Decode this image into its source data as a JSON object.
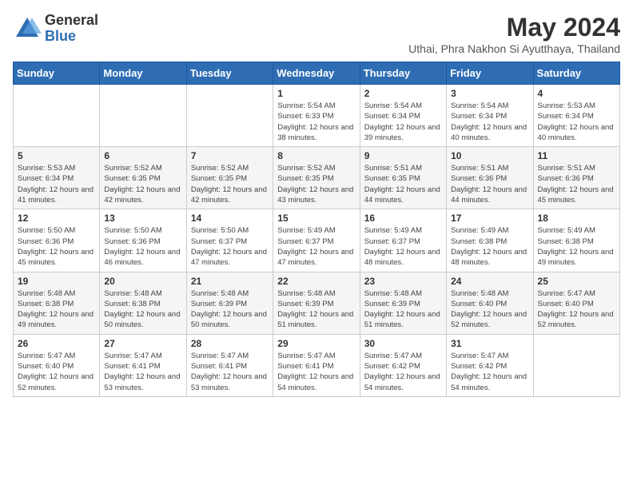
{
  "header": {
    "logo_general": "General",
    "logo_blue": "Blue",
    "main_title": "May 2024",
    "subtitle": "Uthai, Phra Nakhon Si Ayutthaya, Thailand"
  },
  "weekdays": [
    "Sunday",
    "Monday",
    "Tuesday",
    "Wednesday",
    "Thursday",
    "Friday",
    "Saturday"
  ],
  "weeks": [
    [
      {
        "day": "",
        "info": ""
      },
      {
        "day": "",
        "info": ""
      },
      {
        "day": "",
        "info": ""
      },
      {
        "day": "1",
        "info": "Sunrise: 5:54 AM\nSunset: 6:33 PM\nDaylight: 12 hours and 38 minutes."
      },
      {
        "day": "2",
        "info": "Sunrise: 5:54 AM\nSunset: 6:34 PM\nDaylight: 12 hours and 39 minutes."
      },
      {
        "day": "3",
        "info": "Sunrise: 5:54 AM\nSunset: 6:34 PM\nDaylight: 12 hours and 40 minutes."
      },
      {
        "day": "4",
        "info": "Sunrise: 5:53 AM\nSunset: 6:34 PM\nDaylight: 12 hours and 40 minutes."
      }
    ],
    [
      {
        "day": "5",
        "info": "Sunrise: 5:53 AM\nSunset: 6:34 PM\nDaylight: 12 hours and 41 minutes."
      },
      {
        "day": "6",
        "info": "Sunrise: 5:52 AM\nSunset: 6:35 PM\nDaylight: 12 hours and 42 minutes."
      },
      {
        "day": "7",
        "info": "Sunrise: 5:52 AM\nSunset: 6:35 PM\nDaylight: 12 hours and 42 minutes."
      },
      {
        "day": "8",
        "info": "Sunrise: 5:52 AM\nSunset: 6:35 PM\nDaylight: 12 hours and 43 minutes."
      },
      {
        "day": "9",
        "info": "Sunrise: 5:51 AM\nSunset: 6:35 PM\nDaylight: 12 hours and 44 minutes."
      },
      {
        "day": "10",
        "info": "Sunrise: 5:51 AM\nSunset: 6:36 PM\nDaylight: 12 hours and 44 minutes."
      },
      {
        "day": "11",
        "info": "Sunrise: 5:51 AM\nSunset: 6:36 PM\nDaylight: 12 hours and 45 minutes."
      }
    ],
    [
      {
        "day": "12",
        "info": "Sunrise: 5:50 AM\nSunset: 6:36 PM\nDaylight: 12 hours and 45 minutes."
      },
      {
        "day": "13",
        "info": "Sunrise: 5:50 AM\nSunset: 6:36 PM\nDaylight: 12 hours and 46 minutes."
      },
      {
        "day": "14",
        "info": "Sunrise: 5:50 AM\nSunset: 6:37 PM\nDaylight: 12 hours and 47 minutes."
      },
      {
        "day": "15",
        "info": "Sunrise: 5:49 AM\nSunset: 6:37 PM\nDaylight: 12 hours and 47 minutes."
      },
      {
        "day": "16",
        "info": "Sunrise: 5:49 AM\nSunset: 6:37 PM\nDaylight: 12 hours and 48 minutes."
      },
      {
        "day": "17",
        "info": "Sunrise: 5:49 AM\nSunset: 6:38 PM\nDaylight: 12 hours and 48 minutes."
      },
      {
        "day": "18",
        "info": "Sunrise: 5:49 AM\nSunset: 6:38 PM\nDaylight: 12 hours and 49 minutes."
      }
    ],
    [
      {
        "day": "19",
        "info": "Sunrise: 5:48 AM\nSunset: 6:38 PM\nDaylight: 12 hours and 49 minutes."
      },
      {
        "day": "20",
        "info": "Sunrise: 5:48 AM\nSunset: 6:38 PM\nDaylight: 12 hours and 50 minutes."
      },
      {
        "day": "21",
        "info": "Sunrise: 5:48 AM\nSunset: 6:39 PM\nDaylight: 12 hours and 50 minutes."
      },
      {
        "day": "22",
        "info": "Sunrise: 5:48 AM\nSunset: 6:39 PM\nDaylight: 12 hours and 51 minutes."
      },
      {
        "day": "23",
        "info": "Sunrise: 5:48 AM\nSunset: 6:39 PM\nDaylight: 12 hours and 51 minutes."
      },
      {
        "day": "24",
        "info": "Sunrise: 5:48 AM\nSunset: 6:40 PM\nDaylight: 12 hours and 52 minutes."
      },
      {
        "day": "25",
        "info": "Sunrise: 5:47 AM\nSunset: 6:40 PM\nDaylight: 12 hours and 52 minutes."
      }
    ],
    [
      {
        "day": "26",
        "info": "Sunrise: 5:47 AM\nSunset: 6:40 PM\nDaylight: 12 hours and 52 minutes."
      },
      {
        "day": "27",
        "info": "Sunrise: 5:47 AM\nSunset: 6:41 PM\nDaylight: 12 hours and 53 minutes."
      },
      {
        "day": "28",
        "info": "Sunrise: 5:47 AM\nSunset: 6:41 PM\nDaylight: 12 hours and 53 minutes."
      },
      {
        "day": "29",
        "info": "Sunrise: 5:47 AM\nSunset: 6:41 PM\nDaylight: 12 hours and 54 minutes."
      },
      {
        "day": "30",
        "info": "Sunrise: 5:47 AM\nSunset: 6:42 PM\nDaylight: 12 hours and 54 minutes."
      },
      {
        "day": "31",
        "info": "Sunrise: 5:47 AM\nSunset: 6:42 PM\nDaylight: 12 hours and 54 minutes."
      },
      {
        "day": "",
        "info": ""
      }
    ]
  ]
}
